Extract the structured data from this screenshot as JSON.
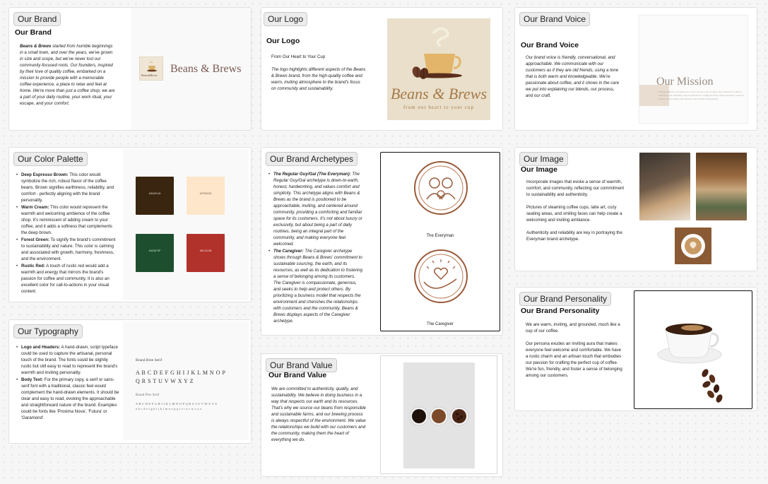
{
  "brand": {
    "pill": "Our Brand",
    "heading": "Our Brand",
    "lead": "Beans & Brews",
    "body": " started from humble beginnings in a small town, and over the years, we've grown in size and scope, but we've never lost our community-focused roots. Our founders, inspired by their love of quality coffee, embarked on a mission to provide people with a memorable coffee experience, a place to relax and feel at home. We're more than just a coffee shop, we are a part of your daily routine, your work ritual, your escape, and your comfort.",
    "logo_text": "Beans & Brews",
    "logo_small": "Beans&Brews"
  },
  "logo": {
    "pill": "Our Logo",
    "heading": "Our Logo",
    "tagline": "From Our Heart to Your Cup",
    "body": "The logo highlights different aspects of the Beans & Brews brand, from the high-quality coffee and warm, inviting atmosphere to the brand's focus on community and sustainability.",
    "wordmark": "Beans & Brews",
    "slogan": "from our heart to your cup"
  },
  "voice": {
    "pill": "Our Brand Voice",
    "heading": "Our Brand Voice",
    "body": "Our brand voice is friendly, conversational, and approachable. We communicate with our customers as if they are old friends, using a tone that is both warm and knowledgeable. We're passionate about coffee, and it shows in the care we put into explaining our blends, our process, and our craft.",
    "mission_title": "Our Mission",
    "mission_text": "At Beans & Brews, our mission is to serve not just a cup of coffee, but a moment of comfort, connection, and community. We are dedicated to crafting the finest coffee experience, rooted in authenticity and quality, and delivered with warmth and hospitality."
  },
  "palette": {
    "pill": "Our Color Palette",
    "items": [
      {
        "name": "Deep Espresso Brown:",
        "text": " This color would symbolize the rich, robust flavor of the coffee beans. Brown signifies earthiness, reliability, and comfort - perfectly aligning with the brand personality."
      },
      {
        "name": "Warm Cream:",
        "text": " This color would represent the warmth and welcoming ambience of the coffee shop. It's reminiscent of adding cream to your coffee, and it adds a softness that complements the deep brown."
      },
      {
        "name": "Forest Green:",
        "text": " To signify the brand's commitment to sustainability and nature. This color is calming and associated with growth, harmony, freshness, and the environment."
      },
      {
        "name": "Rustic Red:",
        "text": " A touch of rustic red would add a warmth and energy that mirrors the brand's passion for coffee and community. It is also an excellent color for call-to-actions in your visual content."
      }
    ],
    "swatches": [
      {
        "hex": "#392510",
        "color": "#392510",
        "text_color": "#e8ddd0"
      },
      {
        "hex": "#FDE6C9",
        "color": "#FDE6C9",
        "text_color": "#6a5a48"
      },
      {
        "hex": "#1D4F2F",
        "color": "#1D4F2F",
        "text_color": "#d8e8dc"
      },
      {
        "hex": "#B1322B",
        "color": "#B1322B",
        "text_color": "#f6dcd9"
      }
    ]
  },
  "typography": {
    "pill": "Our Typography",
    "items": [
      {
        "name": "Logo and Headers:",
        "text": " A hand-drawn, script typeface could be used to capture the artisanal, personal touch of the brand. The fonts could be slightly rustic but still easy to read to represent the brand's warmth and inviting personality."
      },
      {
        "name": "Body Text:",
        "text": " For the primary copy, a serif or sans-serif font with a traditional, classic feel would complement the hand-drawn elements. It should be clear and easy to read, evoking the approachable and straightforward nature of the brand. Examples could be fonts like 'Proxima Nova', 'Futura' or 'Garamond'."
      }
    ],
    "sample1_label": "Brand Bree Serif",
    "sample1_glyphs": "A B C D E F G H I J K L M N O P Q R S T U V W X Y Z",
    "sample2_label": "Brand Flex Serif",
    "sample2_upper": "A B C D E F G H I J K L M N O P Q R S T U V W X Y Z",
    "sample2_lower": "a b c d e f g h i j k l m n o p q r s t u v w x y z"
  },
  "archetypes": {
    "pill": "Our Brand Archetypes",
    "items": [
      {
        "name": "The Regular Guy/Gal (The Everyman):",
        "text": " The Regular Guy/Gal archetype is down-to-earth, honest, hardworking, and values comfort and simplicity. This archetype aligns with Beans & Brews as the brand is positioned to be approachable, inviting, and centered around community, providing a comforting and familiar space for its customers. It's not about luxury or exclusivity, but about being a part of daily routines, being an integral part of the community, and making everyone feel welcomed."
      },
      {
        "name": "The Caregiver:",
        "text": " The Caregiver archetype shows through Beans & Brews' commitment to sustainable sourcing, the earth, and its resources, as well as its dedication to fostering a sense of belonging among its customers. The Caregiver is compassionate, generous, and seeks to help and protect others. By prioritizing a business model that respects the environment and cherishes the relationships with customers and the community, Beans & Brews displays aspects of the Caregiver archetype."
      }
    ],
    "caption1": "The Everyman",
    "caption2": "The Caregiver"
  },
  "value": {
    "pill": "Our Brand Value",
    "heading": "Our Brand Value",
    "body": "We are committed to authenticity, quality, and sustainability. We believe in doing business in a way that respects our earth and its resources. That's why we source our beans from responsible and sustainable farms, and our brewing process is always respectful of the environment. We value the relationships we build with our customers and the community, making them the heart of everything we do."
  },
  "image": {
    "pill": "Our Image",
    "heading": "Our Image",
    "paragraphs": [
      "Incorporate images that evoke a sense of warmth, comfort, and community, reflecting our commitment to sustainability and authenticity.",
      "Pictures of steaming coffee cups, latte art, cozy seating areas, and smiling faces can help create a welcoming and inviting ambiance.",
      "Authenticity and reliability are key in portraying the Everyman brand archetype."
    ]
  },
  "personality": {
    "pill": "Our Brand Personality",
    "heading": "Our Brand Personality",
    "paragraphs": [
      "We are warm, inviting, and grounded, much like a cup of our coffee.",
      "Our persona exudes an inviting aura that makes everyone feel welcome and comfortable. We have a rustic charm and an artisan touch that embodies our passion for crafting the perfect cup of coffee. We're fun, friendly, and foster a sense of belonging among our customers."
    ]
  },
  "icons": [
    "coffee-cup-logo-icon",
    "everyman-people-icon",
    "caregiver-hands-heart-icon"
  ]
}
